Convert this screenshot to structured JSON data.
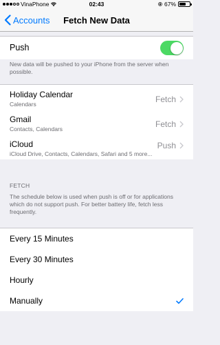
{
  "status_bar": {
    "carrier": "VinaPhone",
    "time": "02:43",
    "battery_percent": "67%",
    "battery_level": 0.67
  },
  "nav": {
    "back_label": "Accounts",
    "title": "Fetch New Data"
  },
  "push": {
    "label": "Push",
    "enabled": true,
    "description": "New data will be pushed to your iPhone from the server when possible."
  },
  "accounts": [
    {
      "name": "Holiday Calendar",
      "services": "Calendars",
      "value": "Fetch"
    },
    {
      "name": "Gmail",
      "services": "Contacts, Calendars",
      "value": "Fetch"
    },
    {
      "name": "iCloud",
      "services": "iCloud Drive, Contacts, Calendars, Safari and 5 more...",
      "value": "Push"
    }
  ],
  "fetch": {
    "header": "FETCH",
    "description": "The schedule below is used when push is off or for applications which do not support push. For better battery life, fetch less frequently.",
    "options": [
      {
        "label": "Every 15 Minutes",
        "selected": false
      },
      {
        "label": "Every 30 Minutes",
        "selected": false
      },
      {
        "label": "Hourly",
        "selected": false
      },
      {
        "label": "Manually",
        "selected": true
      }
    ]
  },
  "colors": {
    "accent": "#007aff",
    "toggle_on": "#4cd964",
    "background": "#efeff4"
  }
}
